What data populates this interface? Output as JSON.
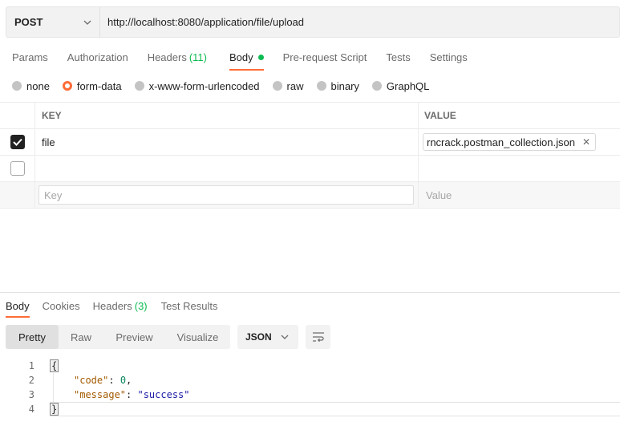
{
  "request": {
    "method": "POST",
    "url": "http://localhost:8080/application/file/upload"
  },
  "request_tabs": [
    {
      "label": "Params",
      "count": ""
    },
    {
      "label": "Authorization",
      "count": ""
    },
    {
      "label": "Headers",
      "count": "(11)"
    },
    {
      "label": "Body",
      "count": ""
    },
    {
      "label": "Pre-request Script",
      "count": ""
    },
    {
      "label": "Tests",
      "count": ""
    },
    {
      "label": "Settings",
      "count": ""
    }
  ],
  "active_request_tab": "Body",
  "body_types": [
    "none",
    "form-data",
    "x-www-form-urlencoded",
    "raw",
    "binary",
    "GraphQL"
  ],
  "selected_body_type": "form-data",
  "form_table": {
    "headers": {
      "key": "KEY",
      "value": "VALUE"
    },
    "rows": [
      {
        "checked": true,
        "key": "file",
        "value": "rncrack.postman_collection.json"
      }
    ],
    "new_key_placeholder": "Key",
    "new_value_placeholder": "Value"
  },
  "response_tabs": [
    {
      "label": "Body",
      "count": ""
    },
    {
      "label": "Cookies",
      "count": ""
    },
    {
      "label": "Headers",
      "count": "(3)"
    },
    {
      "label": "Test Results",
      "count": ""
    }
  ],
  "active_response_tab": "Body",
  "view_modes": [
    "Pretty",
    "Raw",
    "Preview",
    "Visualize"
  ],
  "active_view_mode": "Pretty",
  "format": "JSON",
  "response_code": {
    "line_numbers": [
      "1",
      "2",
      "3",
      "4"
    ],
    "open_brace": "{",
    "close_brace": "}",
    "code_key": "\"code\"",
    "code_value": "0",
    "message_key": "\"message\"",
    "message_value": "\"success\""
  },
  "colors": {
    "accent": "#ff6c37",
    "active_dot": "#0cbb52"
  }
}
